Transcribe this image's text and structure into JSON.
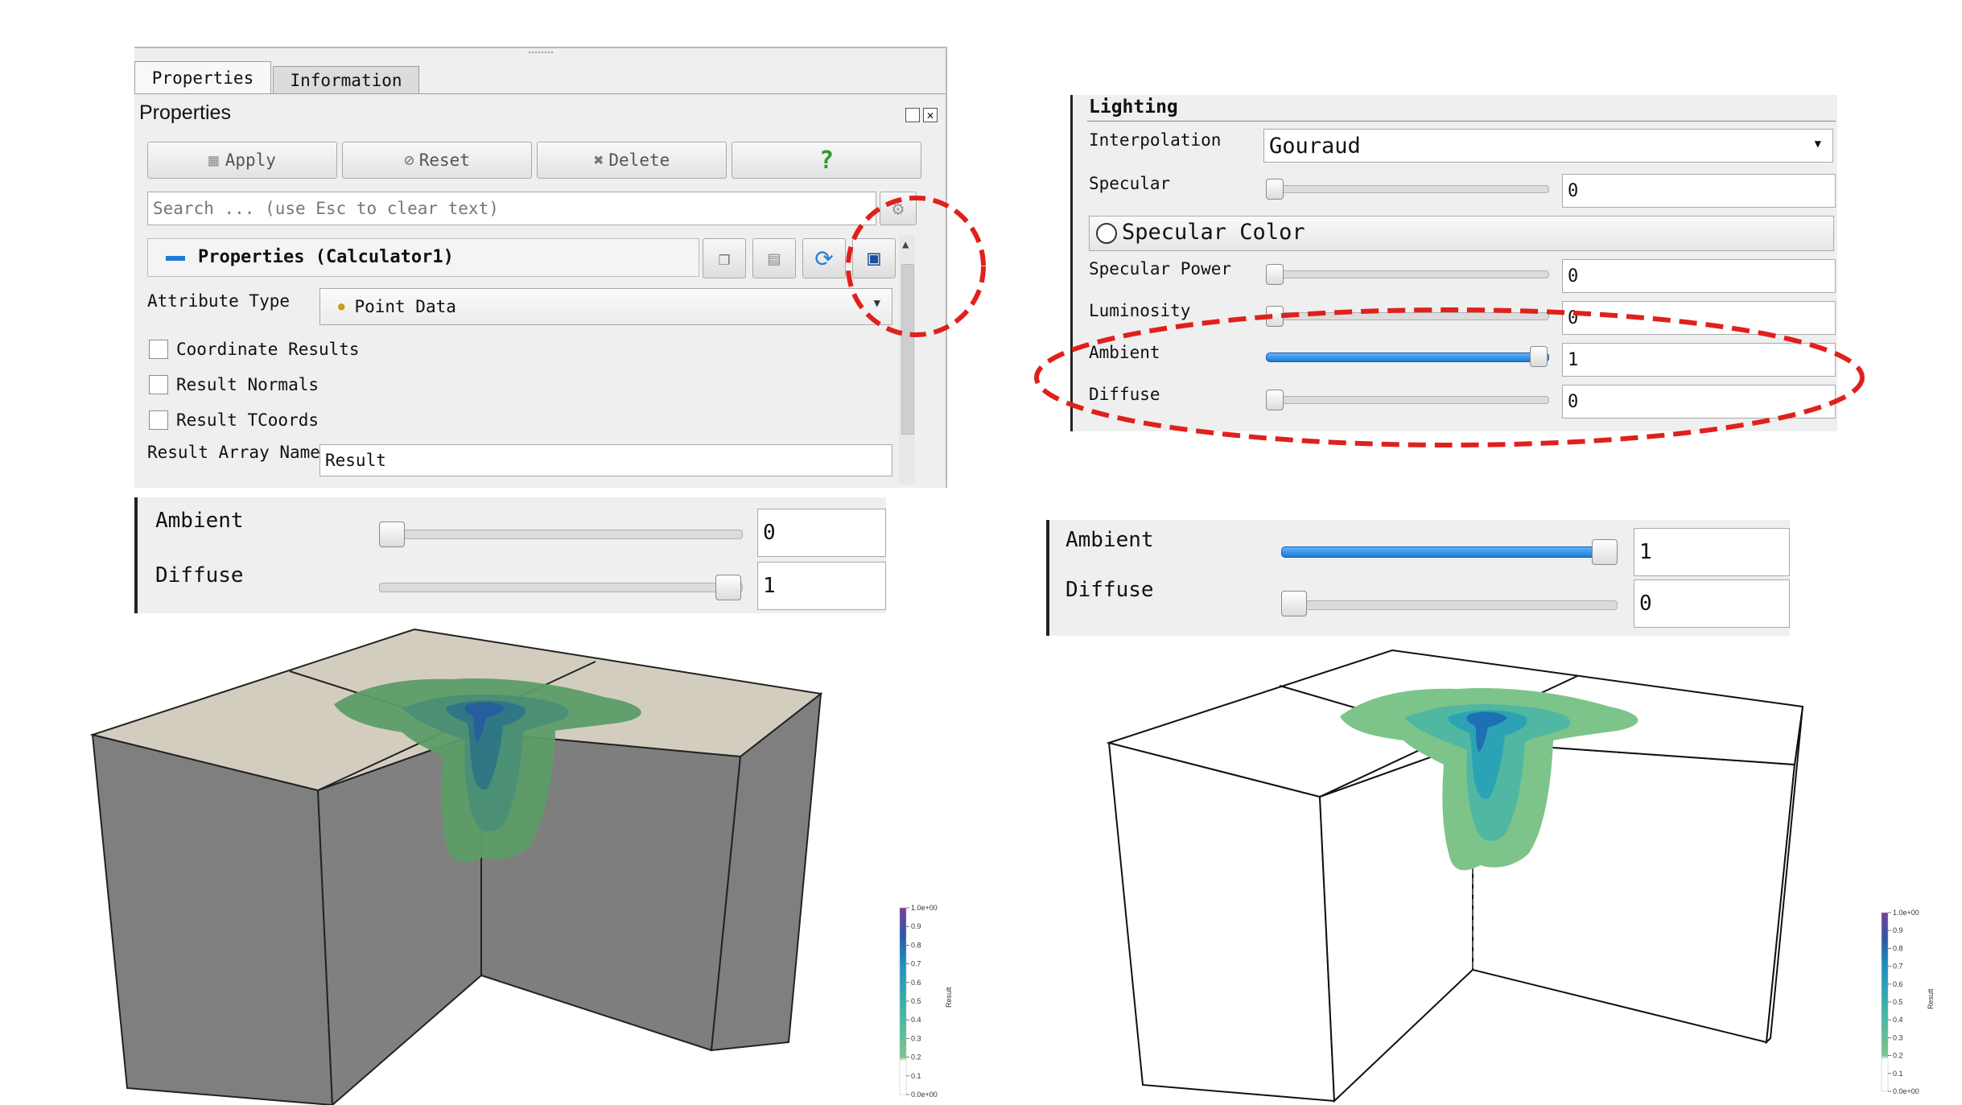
{
  "left_panel": {
    "tabs": [
      {
        "label": "Properties"
      },
      {
        "label": "Information"
      }
    ],
    "title": "Properties",
    "buttons": {
      "apply": "Apply",
      "reset": "Reset",
      "delete": "Delete",
      "help": "?"
    },
    "search_placeholder": "Search ... (use Esc to clear text)",
    "section_title": "Properties (Calculator1)",
    "attribute_type_label": "Attribute Type",
    "attribute_type_value": "Point Data",
    "checkboxes": [
      {
        "label": "Coordinate Results",
        "checked": false
      },
      {
        "label": "Result Normals",
        "checked": false
      },
      {
        "label": "Result TCoords",
        "checked": false
      }
    ],
    "result_array_label": "Result Array Name",
    "result_array_value": "Result"
  },
  "lighting_panel": {
    "title": "Lighting",
    "interpolation_label": "Interpolation",
    "interpolation_value": "Gouraud",
    "specular_label": "Specular",
    "specular_value": "0",
    "specular_color_label": "Specular Color",
    "specular_power_label": "Specular Power",
    "specular_power_value": "0",
    "luminosity_label": "Luminosity",
    "luminosity_value": "0",
    "ambient_label": "Ambient",
    "ambient_value": "1",
    "diffuse_label": "Diffuse",
    "diffuse_value": "0"
  },
  "strip_left": {
    "ambient_label": "Ambient",
    "ambient_value": "0",
    "ambient_level": 0,
    "diffuse_label": "Diffuse",
    "diffuse_value": "1",
    "diffuse_level": 1
  },
  "strip_right": {
    "ambient_label": "Ambient",
    "ambient_value": "1",
    "ambient_level": 1,
    "diffuse_label": "Diffuse",
    "diffuse_value": "0",
    "diffuse_level": 0
  },
  "colorbar": {
    "title": "Result",
    "ticks": [
      "1.0e+00",
      "0.9",
      "0.8",
      "0.7",
      "0.6",
      "0.5",
      "0.4",
      "0.3",
      "0.2",
      "0.1",
      "0.0e+00"
    ]
  },
  "colors": {
    "highlight": "#e0201c",
    "slider_accent": "#1e7ad6",
    "box_dark": "#7f7f7f",
    "box_top": "#d3cdc0"
  },
  "icons": [
    "apply-icon",
    "reset-icon",
    "delete-icon",
    "help-icon",
    "gear-icon",
    "copy-icon",
    "paste-icon",
    "refresh-icon",
    "save-icon",
    "dropdown-arrow-icon",
    "scroll-up-icon"
  ]
}
